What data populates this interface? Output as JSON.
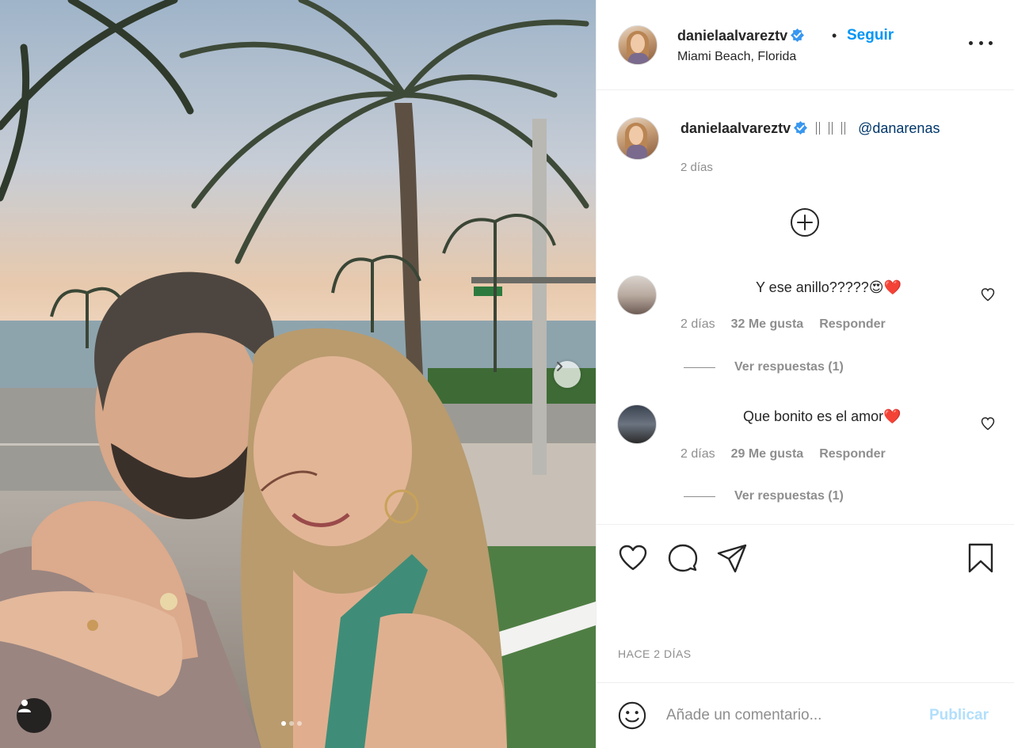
{
  "post": {
    "photo_carousel": {
      "count": 3,
      "active_index": 0
    }
  },
  "header": {
    "username": "danielaalvareztv",
    "separator": "•",
    "follow_label": "Seguir",
    "location": "Miami Beach, Florida"
  },
  "caption": {
    "username": "danielaalvareztv",
    "emoji_text": "",
    "mention": "@danarenas",
    "time": "2 días"
  },
  "comments": [
    {
      "text": "Y ese anillo?????😍❤️",
      "time": "2 días",
      "likes": "32 Me gusta",
      "reply_label": "Responder",
      "replies_label": "Ver respuestas (1)"
    },
    {
      "text": "Que bonito es el amor❤️",
      "time": "2 días",
      "likes": "29 Me gusta",
      "reply_label": "Responder",
      "replies_label": "Ver respuestas (1)"
    }
  ],
  "post_time": "HACE 2 DÍAS",
  "comment_box": {
    "placeholder": "Añade un comentario...",
    "publish_label": "Publicar"
  },
  "colors": {
    "accent": "#0095f6",
    "publish_disabled": "#b2dffc",
    "muted_text": "#8e8e8e",
    "verified": "#3897f0",
    "mention": "#00376b"
  },
  "icons": [
    "verified-badge-icon",
    "more-options-icon",
    "load-more-comments-icon",
    "heart-icon",
    "comment-icon",
    "share-icon",
    "bookmark-icon",
    "emoji-icon",
    "tag-user-icon",
    "chevron-right-icon"
  ]
}
